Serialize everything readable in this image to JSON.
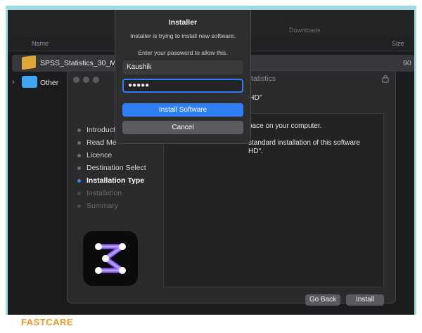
{
  "finder": {
    "title": "",
    "downloads_title": "Downloads",
    "columns": {
      "name": "Name",
      "size": "Size"
    },
    "rows": [
      {
        "name": "SPSS_Statistics_30_M",
        "size": "90",
        "icon": "package-icon"
      },
      {
        "name": "Other",
        "icon": "folder-icon"
      }
    ]
  },
  "installer": {
    "title_fragment": "Statistics",
    "destination_fragment": "osh HD\"",
    "content_lines": [
      "pace on your computer.",
      "standard installation of this software",
      "HD\"."
    ],
    "sidebar": [
      {
        "label": "Introduct",
        "state": "done"
      },
      {
        "label": "Read Me",
        "state": "done"
      },
      {
        "label": "Licence",
        "state": "done"
      },
      {
        "label": "Destination Select",
        "state": "done"
      },
      {
        "label": "Installation Type",
        "state": "active"
      },
      {
        "label": "Installation",
        "state": "pending"
      },
      {
        "label": "Summary",
        "state": "pending"
      }
    ],
    "buttons": {
      "go_back": "Go Back",
      "install": "Install"
    }
  },
  "dialog": {
    "title": "Installer",
    "message": "Installer is trying to install new software.",
    "prompt": "Enter your password to allow this.",
    "username": "Kaushik",
    "password_mask": "●●●●●",
    "primary_button": "Install Software",
    "cancel_button": "Cancel"
  },
  "watermark": "FASTCARE",
  "colors": {
    "accent": "#2f7ef5",
    "frame": "#9fdce0",
    "brand": "#f0982c"
  }
}
